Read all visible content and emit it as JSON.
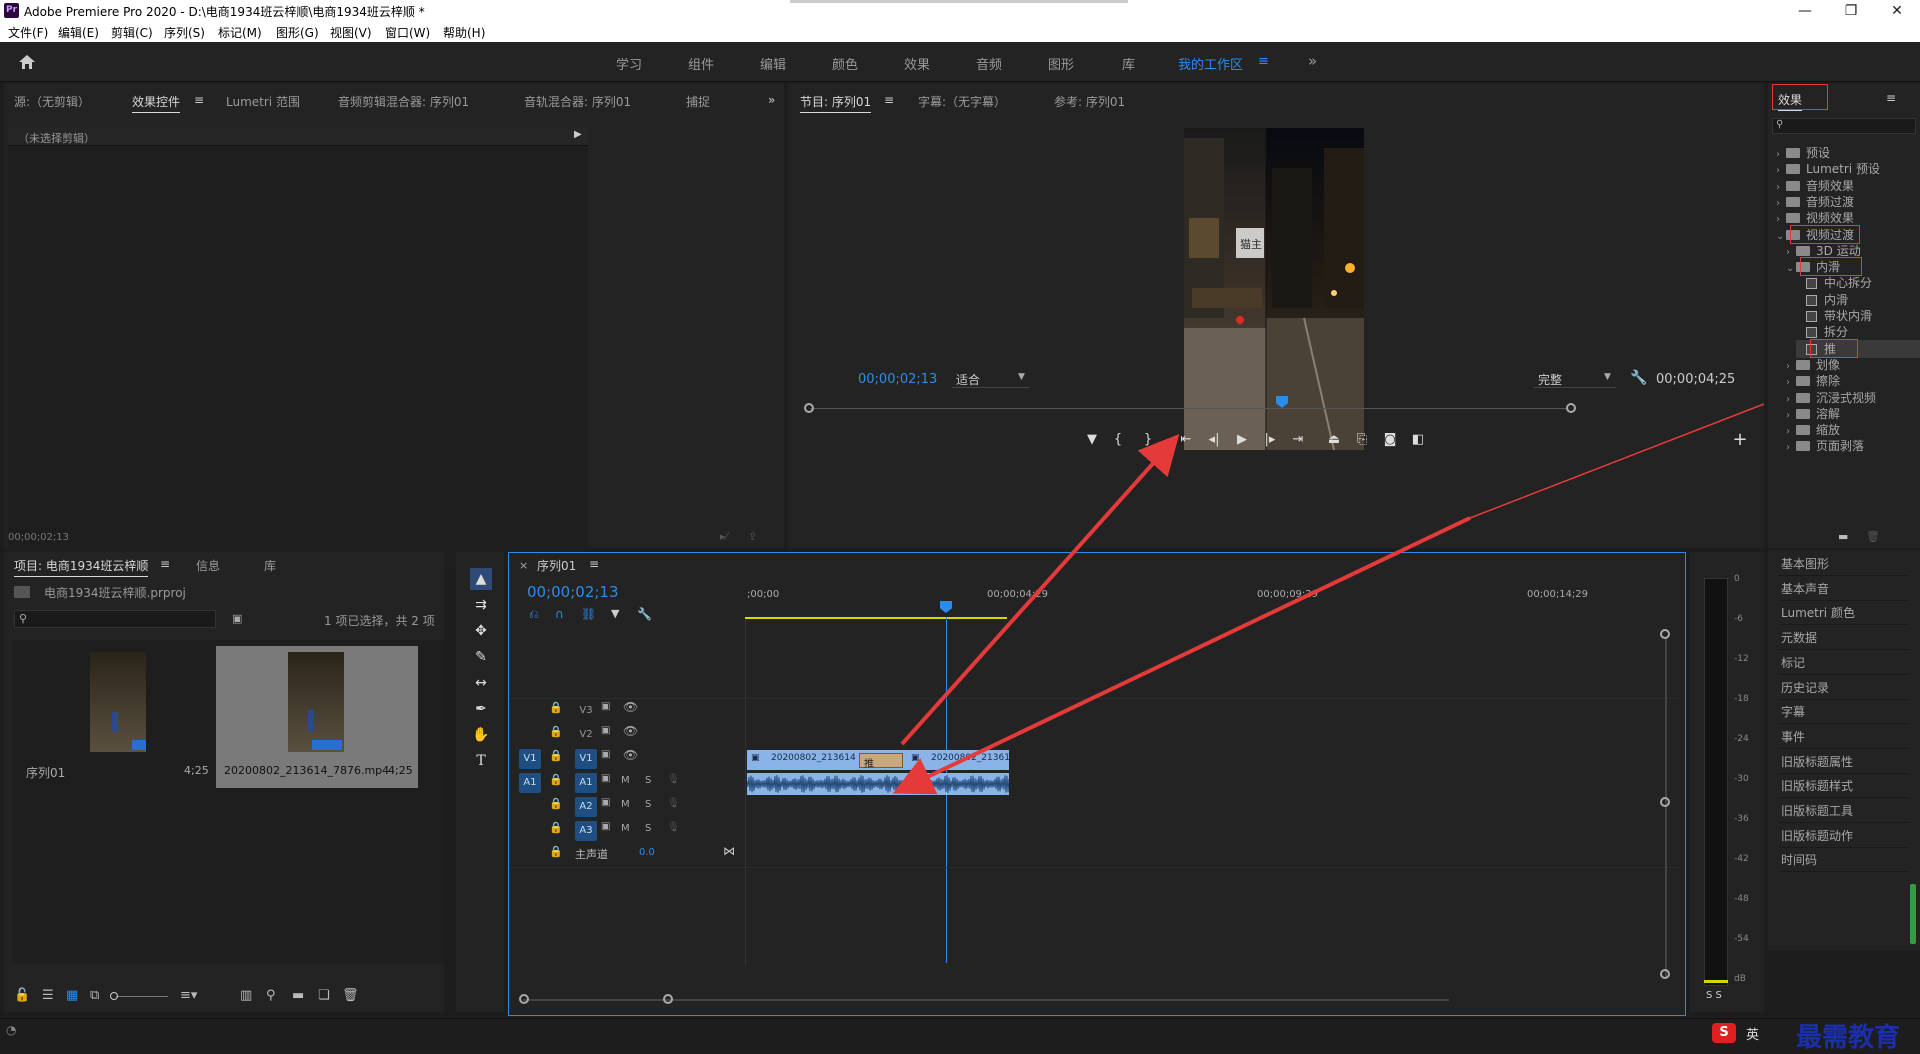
{
  "app": {
    "title": "Adobe Premiere Pro 2020 - D:\\电商1934班云梓顺\\电商1934班云梓顺 *",
    "logo": "Pr"
  },
  "window_controls": {
    "minimize": "—",
    "maximize": "❐",
    "close": "✕"
  },
  "menu": [
    "文件(F)",
    "编辑(E)",
    "剪辑(C)",
    "序列(S)",
    "标记(M)",
    "图形(G)",
    "视图(V)",
    "窗口(W)",
    "帮助(H)"
  ],
  "workspaces": {
    "items": [
      "学习",
      "组件",
      "编辑",
      "颜色",
      "效果",
      "音频",
      "图形",
      "库",
      "我的工作区"
    ],
    "active": "我的工作区",
    "more": "»"
  },
  "source_panel": {
    "tabs": [
      "源:（无剪辑）",
      "效果控件",
      "Lumetri 范围",
      "音频剪辑混合器: 序列01",
      "音轨混合器: 序列01",
      "捕捉"
    ],
    "active_tab": "效果控件",
    "no_clip": "（未选择剪辑）",
    "timecode": "00;00;02;13"
  },
  "program_monitor": {
    "tabs": [
      "节目: 序列01",
      "字幕:（无字幕）",
      "参考: 序列01"
    ],
    "timecode": "00;00;02;13",
    "fit": "适合",
    "quality": "完整",
    "duration": "00;00;04;25",
    "sign_text": "猫主"
  },
  "effects_panel": {
    "title": "效果",
    "tree": [
      {
        "label": "预设",
        "level": 0,
        "type": "folder"
      },
      {
        "label": "Lumetri 预设",
        "level": 0,
        "type": "folder"
      },
      {
        "label": "音频效果",
        "level": 0,
        "type": "folder"
      },
      {
        "label": "音频过渡",
        "level": 0,
        "type": "folder"
      },
      {
        "label": "视频效果",
        "level": 0,
        "type": "folder"
      },
      {
        "label": "视频过渡",
        "level": 0,
        "type": "folder",
        "open": true
      },
      {
        "label": "3D 运动",
        "level": 1,
        "type": "folder"
      },
      {
        "label": "内滑",
        "level": 1,
        "type": "folder",
        "open": true
      },
      {
        "label": "中心拆分",
        "level": 2,
        "type": "fx"
      },
      {
        "label": "内滑",
        "level": 2,
        "type": "fx"
      },
      {
        "label": "带状内滑",
        "level": 2,
        "type": "fx"
      },
      {
        "label": "拆分",
        "level": 2,
        "type": "fx"
      },
      {
        "label": "推",
        "level": 2,
        "type": "fx",
        "selected": true
      },
      {
        "label": "划像",
        "level": 1,
        "type": "folder"
      },
      {
        "label": "擦除",
        "level": 1,
        "type": "folder"
      },
      {
        "label": "沉浸式视频",
        "level": 1,
        "type": "folder"
      },
      {
        "label": "溶解",
        "level": 1,
        "type": "folder"
      },
      {
        "label": "缩放",
        "level": 1,
        "type": "folder"
      },
      {
        "label": "页面剥落",
        "level": 1,
        "type": "folder"
      }
    ]
  },
  "side_panels": [
    "基本图形",
    "基本声音",
    "Lumetri 颜色",
    "元数据",
    "标记",
    "历史记录",
    "字幕",
    "事件",
    "旧版标题属性",
    "旧版标题样式",
    "旧版标题工具",
    "旧版标题动作",
    "时间码"
  ],
  "project_panel": {
    "tabs": [
      "项目: 电商1934班云梓顺",
      "信息",
      "库"
    ],
    "file": "电商1934班云梓顺.prproj",
    "selection": "1 项已选择，共 2 项",
    "items": [
      {
        "name": "序列01",
        "duration": "4;25"
      },
      {
        "name": "20200802_213614_7876.mp4",
        "duration": "4;25"
      }
    ]
  },
  "timeline": {
    "tab": "序列01",
    "timecode": "00;00;02;13",
    "ruler": [
      ";00;00",
      "00;00;04;29",
      "00;00;09;29",
      "00;00;14;29"
    ],
    "video_tracks": [
      "V3",
      "V2",
      "V1"
    ],
    "audio_tracks": [
      "A1",
      "A2",
      "A3"
    ],
    "source_v": "V1",
    "source_a": "A1",
    "master": {
      "label": "主声道",
      "value": "0.0"
    },
    "clip_left": "20200802_213614",
    "clip_right": "20200802_21361",
    "transition": "推",
    "mute": "M",
    "solo": "S"
  },
  "meter": {
    "scale": [
      "0",
      "-6",
      "-12",
      "-18",
      "-24",
      "-30",
      "-36",
      "-42",
      "-48",
      "-54",
      "dB"
    ],
    "solo": "S S"
  },
  "taskbar": {
    "ime": "英",
    "watermark": "最需教育"
  }
}
